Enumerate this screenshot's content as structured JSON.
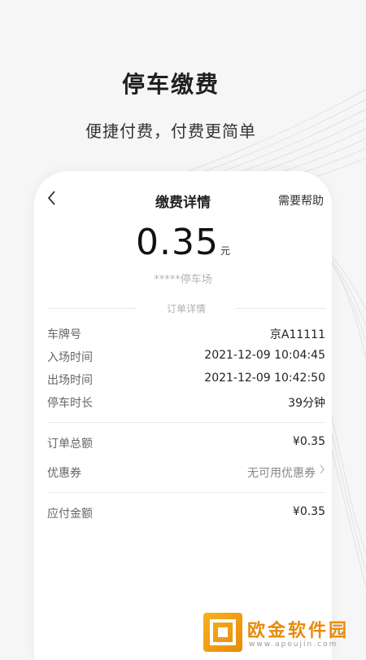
{
  "hero": {
    "title": "停车缴费",
    "subtitle": "便捷付费，付费更简单"
  },
  "nav": {
    "back_icon": "chevron-left-icon",
    "title": "缴费详情",
    "help_label": "需要帮助"
  },
  "payment": {
    "amount": "0.35",
    "unit": "元",
    "lot_name": "*****停车场"
  },
  "order_details": {
    "section_label": "订单详情",
    "rows": [
      {
        "label": "车牌号",
        "value": "京A11111"
      },
      {
        "label": "入场时间",
        "value": "2021-12-09 10:04:45"
      },
      {
        "label": "出场时间",
        "value": "2021-12-09 10:42:50"
      },
      {
        "label": "停车时长",
        "value": "39分钟"
      }
    ]
  },
  "totals": {
    "order_total_label": "订单总额",
    "order_total_value": "¥0.35",
    "coupon_label": "优惠券",
    "coupon_value": "无可用优惠券",
    "payable_label": "应付金额",
    "payable_value": "¥0.35"
  },
  "watermark": {
    "brand": "欧金软件园",
    "url": "www.apoujin.com"
  }
}
